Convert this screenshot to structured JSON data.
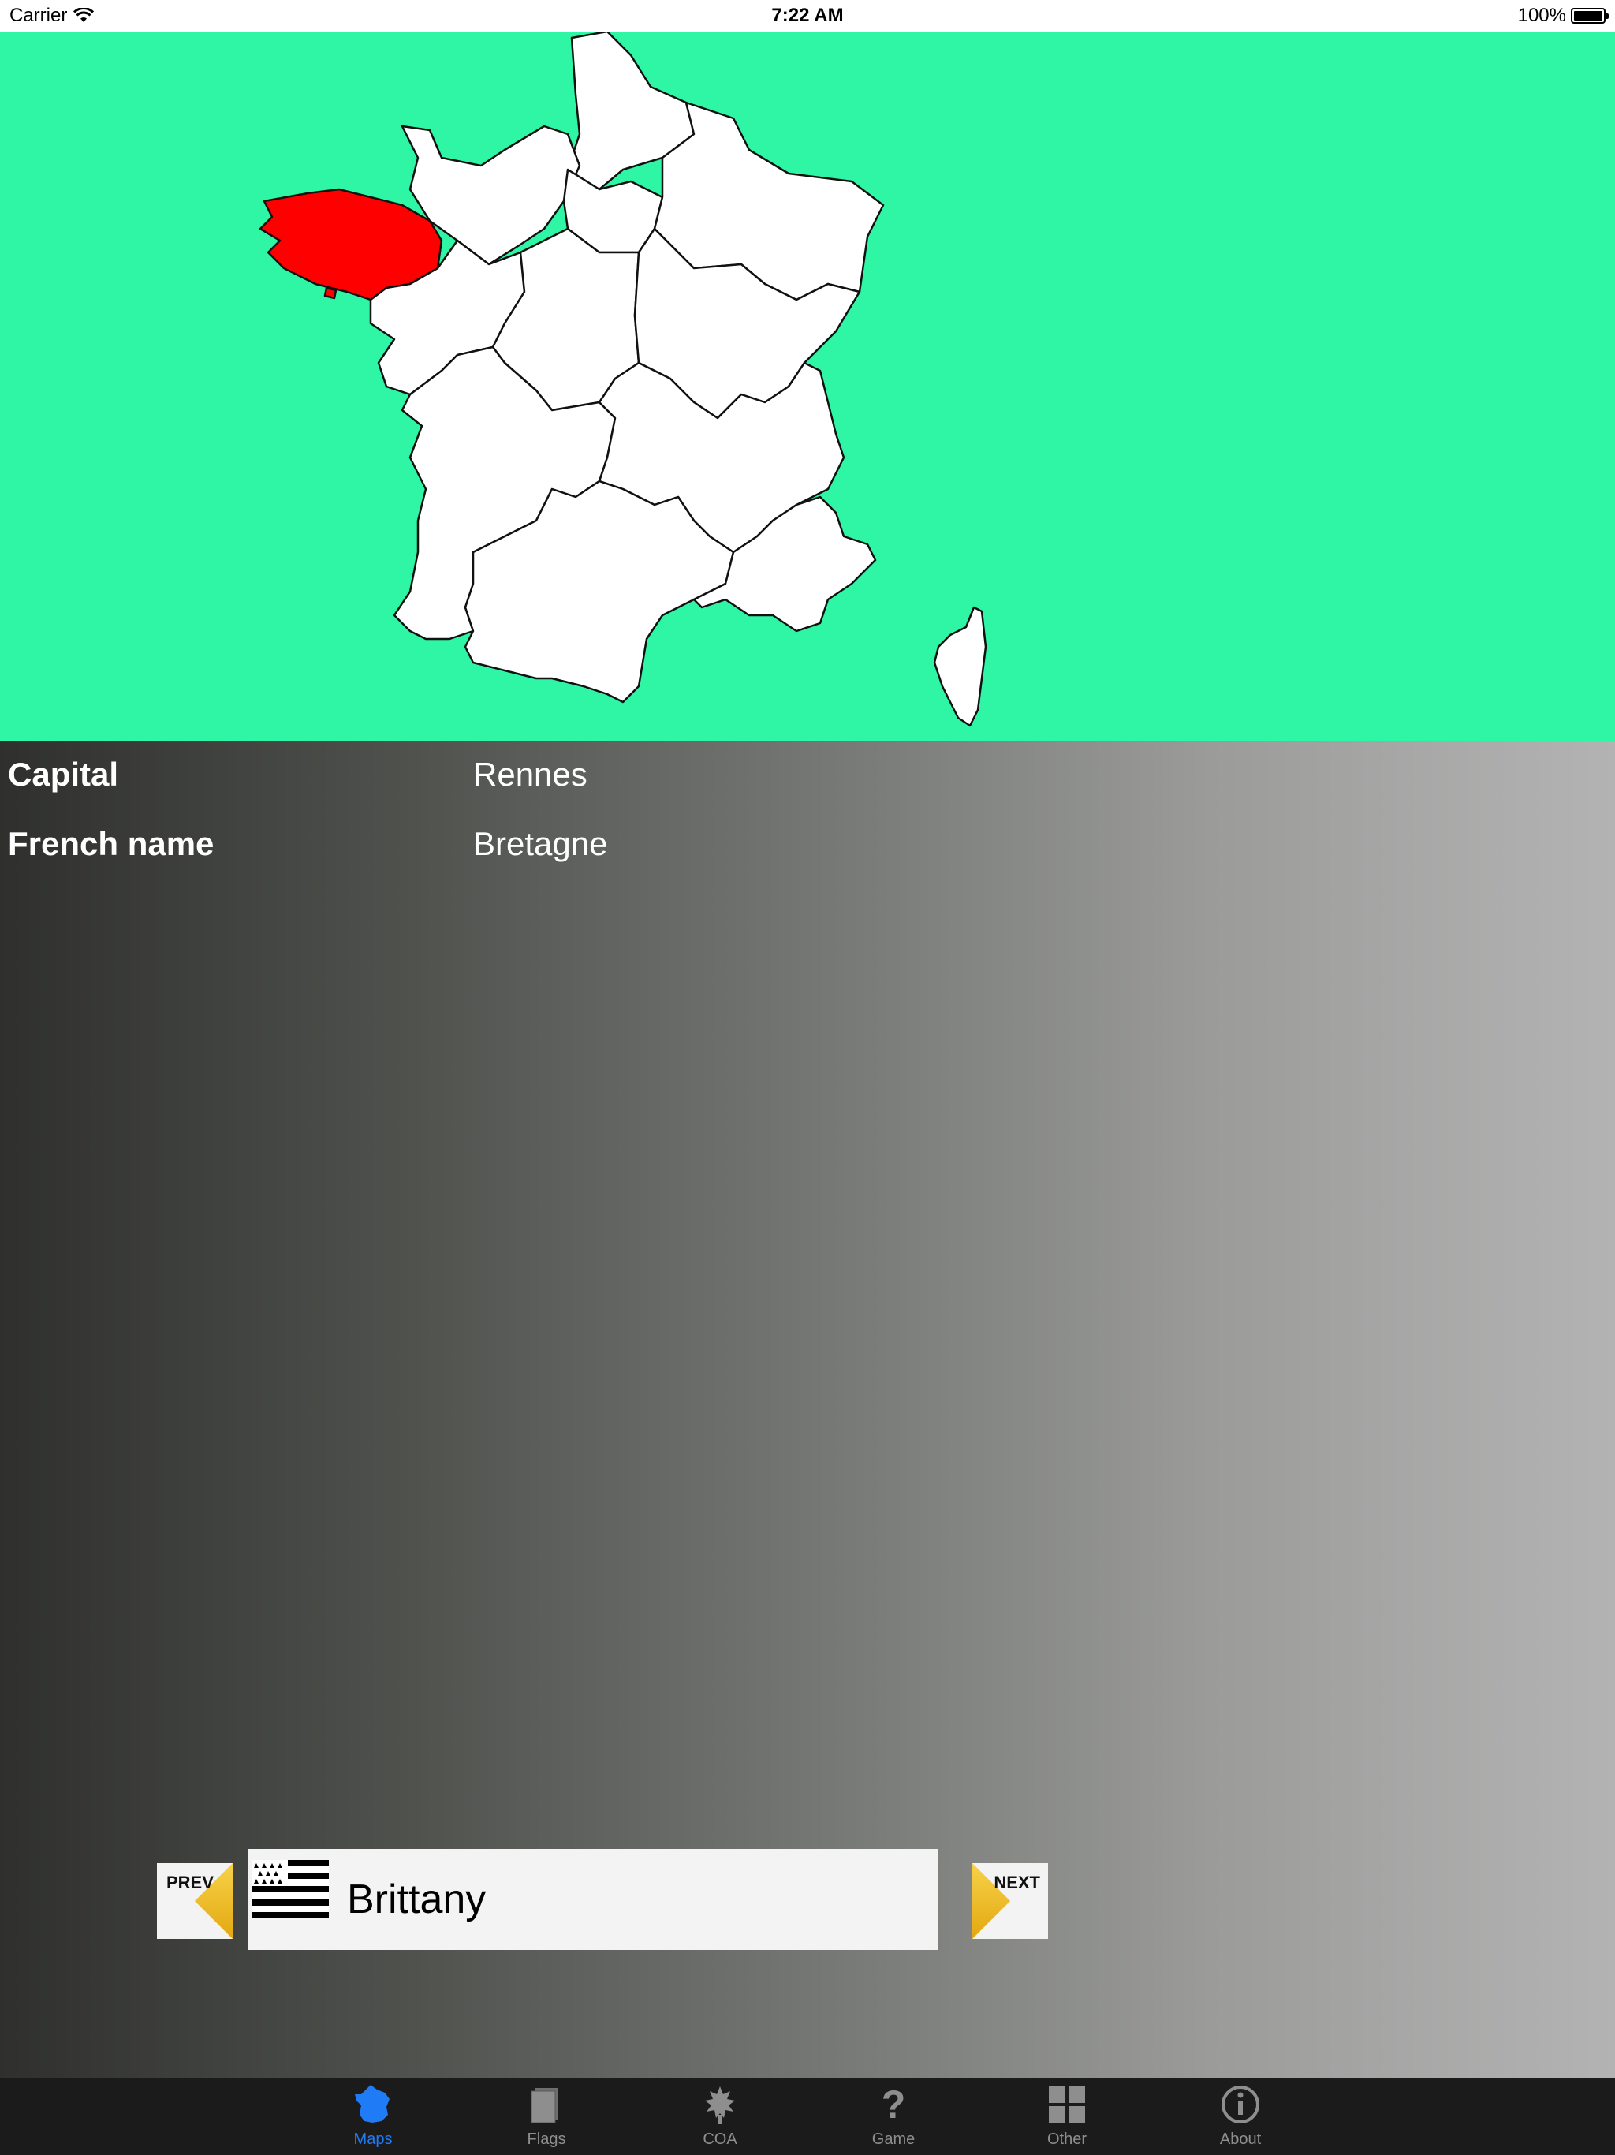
{
  "status_bar": {
    "carrier": "Carrier",
    "time": "7:22 AM",
    "battery": "100%"
  },
  "map": {
    "background_color": "#2ef6a4",
    "highlight_color": "#ff0000",
    "selected_region": "Brittany"
  },
  "details": {
    "capital_label": "Capital",
    "capital_value": "Rennes",
    "french_name_label": "French name",
    "french_name_value": "Bretagne"
  },
  "navigator": {
    "prev_label": "PREV",
    "next_label": "NEXT",
    "region_name": "Brittany",
    "arrow_color": "#f4c22a"
  },
  "tabs": [
    {
      "label": "Maps",
      "icon": "france-map-icon",
      "active": true
    },
    {
      "label": "Flags",
      "icon": "flags-icon",
      "active": false
    },
    {
      "label": "COA",
      "icon": "coat-of-arms-icon",
      "active": false
    },
    {
      "label": "Game",
      "icon": "question-mark-icon",
      "active": false
    },
    {
      "label": "Other",
      "icon": "grid-icon",
      "active": false
    },
    {
      "label": "About",
      "icon": "info-icon",
      "active": false
    }
  ],
  "colors": {
    "active_tab": "#1f7cf6",
    "inactive_tab": "#8e8e8e"
  }
}
